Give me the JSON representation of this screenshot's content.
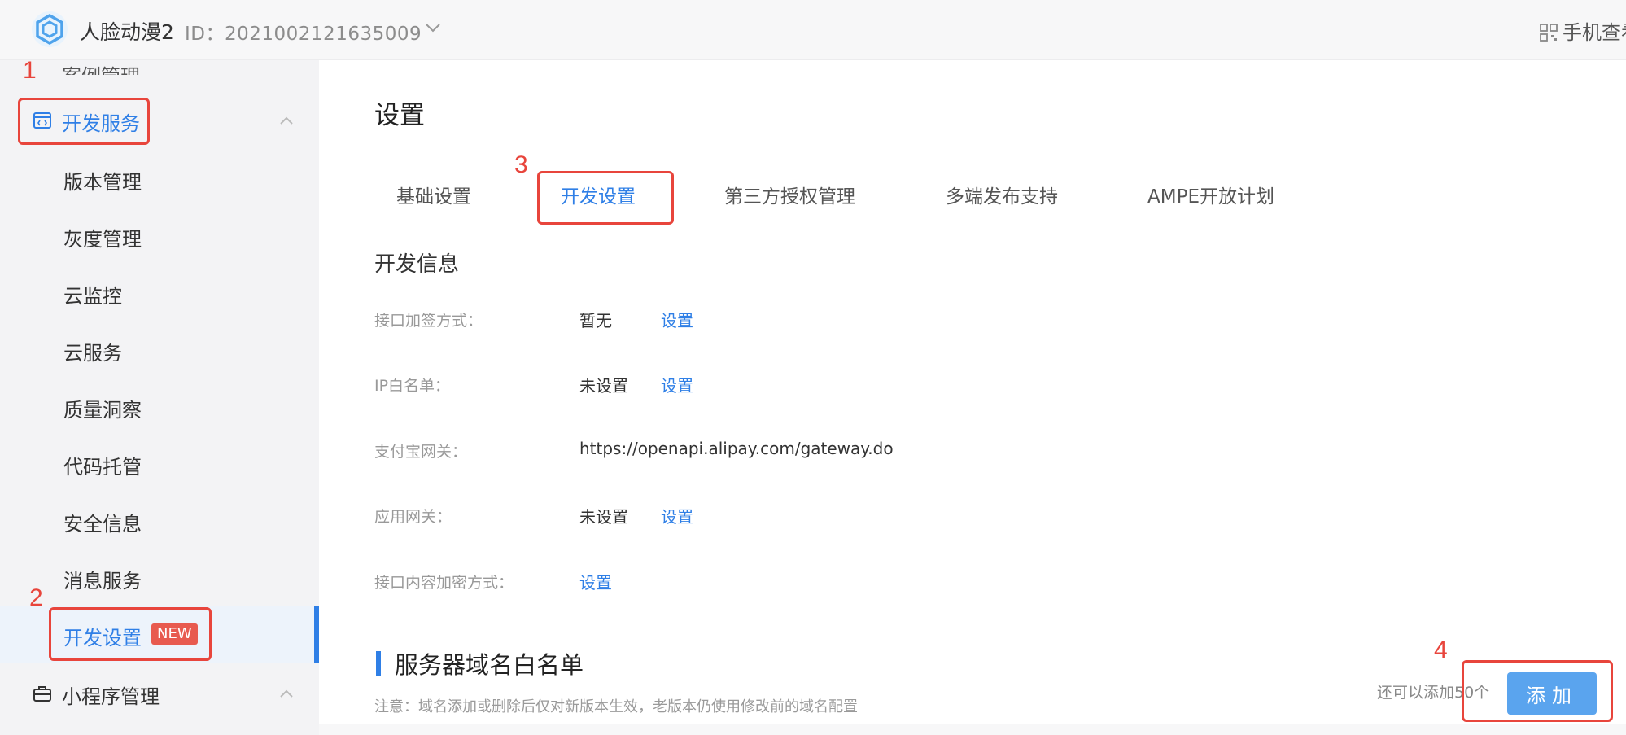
{
  "header": {
    "app_name": "人脸动漫2",
    "app_id": "ID：2021002121635009",
    "mobile_view": "手机查看"
  },
  "sidebar": {
    "top_cut_label": "案例管理",
    "dev_group_label": "开发服务",
    "items": [
      {
        "label": "版本管理"
      },
      {
        "label": "灰度管理"
      },
      {
        "label": "云监控"
      },
      {
        "label": "云服务"
      },
      {
        "label": "质量洞察"
      },
      {
        "label": "代码托管"
      },
      {
        "label": "安全信息"
      },
      {
        "label": "消息服务"
      },
      {
        "label": "开发设置",
        "badge": "NEW",
        "active": true
      }
    ],
    "mini_group_label": "小程序管理"
  },
  "main": {
    "page_title": "设置",
    "tabs": [
      {
        "label": "基础设置"
      },
      {
        "label": "开发设置",
        "active": true
      },
      {
        "label": "第三方授权管理"
      },
      {
        "label": "多端发布支持"
      },
      {
        "label": "AMPE开放计划"
      }
    ],
    "dev_info_title": "开发信息",
    "rows": [
      {
        "label": "接口加签方式：",
        "value": "暂无",
        "link": "设置"
      },
      {
        "label": "IP白名单：",
        "value": "未设置",
        "link": "设置"
      },
      {
        "label": "支付宝网关：",
        "value": "https://openapi.alipay.com/gateway.do"
      },
      {
        "label": "应用网关：",
        "value": "未设置",
        "link": "设置"
      },
      {
        "label": "接口内容加密方式：",
        "link": "设置"
      }
    ],
    "whitelist_title": "服务器域名白名单",
    "note": "注意：域名添加或删除后仅对新版本生效，老版本仍使用修改前的域名配置",
    "remaining": "还可以添加50个",
    "add_button": "添加"
  },
  "annotations": [
    "1",
    "2",
    "3",
    "4"
  ],
  "colors": {
    "accent": "#2f7fe6",
    "annotation": "#e8453c",
    "badge": "#e85a4f",
    "button": "#5aa4ee"
  }
}
